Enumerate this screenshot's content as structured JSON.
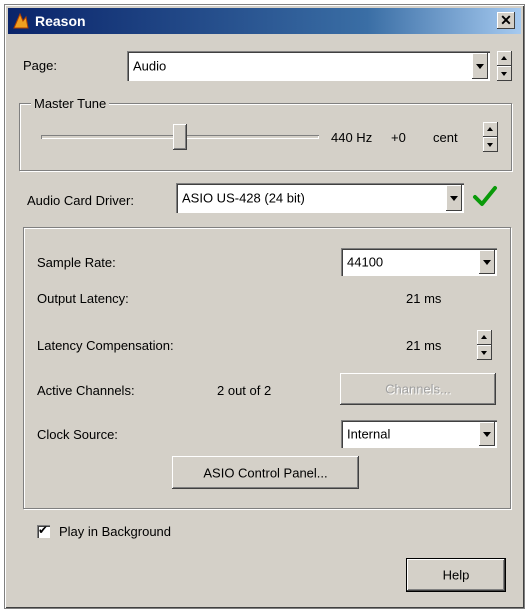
{
  "window": {
    "title": "Reason",
    "close_glyph": "✕",
    "app_icon": "reason-logo-icon"
  },
  "page": {
    "label": "Page:",
    "value": "Audio"
  },
  "master_tune": {
    "group_label": "Master Tune",
    "value": "440 Hz",
    "offset": "+0",
    "unit": "cent",
    "slider_fraction": 0.5
  },
  "audio_card_driver": {
    "label": "Audio Card Driver:",
    "value": "ASIO US-428 (24 bit)",
    "status_icon": "check-icon",
    "status_color": "#0a9a0a"
  },
  "settings": {
    "sample_rate": {
      "label": "Sample Rate:",
      "value": "44100"
    },
    "output_latency": {
      "label": "Output Latency:",
      "value": "21 ms"
    },
    "latency_compensation": {
      "label": "Latency Compensation:",
      "value": "21 ms"
    },
    "active_channels": {
      "label": "Active Channels:",
      "value": "2 out of 2",
      "button_label": "Channels..."
    },
    "clock_source": {
      "label": "Clock Source:",
      "value": "Internal"
    },
    "asio_panel_button": "ASIO Control Panel..."
  },
  "play_in_background": {
    "label": "Play in Background",
    "checked": true,
    "mark": "✔"
  },
  "help_button": "Help"
}
